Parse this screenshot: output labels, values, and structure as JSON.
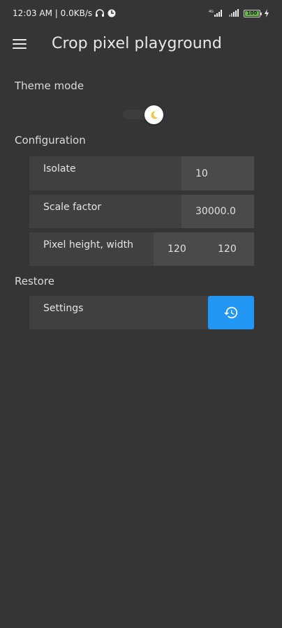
{
  "status_bar": {
    "time_speed": "12:03 AM | 0.0KB/s",
    "network_4g": "4G",
    "battery_level": "100"
  },
  "app_bar": {
    "title": "Crop pixel playground"
  },
  "theme": {
    "section_title": "Theme mode"
  },
  "configuration": {
    "section_title": "Configuration",
    "isolate": {
      "label": "Isolate",
      "value": "10"
    },
    "scale_factor": {
      "label": "Scale factor",
      "value": "30000.0"
    },
    "pixel_size": {
      "label": "Pixel height, width",
      "height": "120",
      "width": "120"
    }
  },
  "restore": {
    "section_title": "Restore",
    "settings_label": "Settings"
  },
  "colors": {
    "background": "#353535",
    "row_background": "#404040",
    "input_background": "#4a4a4a",
    "accent": "#2196f3",
    "battery": "#66bb44"
  },
  "icons": {
    "menu": "hamburger-icon",
    "theme": "moon-icon",
    "restore": "history-icon"
  }
}
